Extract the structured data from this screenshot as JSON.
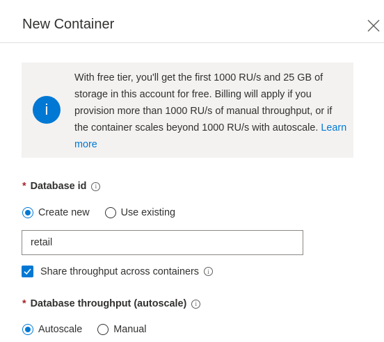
{
  "panel": {
    "title": "New Container",
    "close_icon": "close-icon"
  },
  "info_banner": {
    "icon": "info-icon",
    "icon_glyph": "i",
    "text": "With free tier, you'll get the first 1000 RU/s and 25 GB of storage in this account for free. Billing will apply if you provision more than 1000 RU/s of manual throughput, or if the container scales beyond 1000 RU/s with autoscale.",
    "link_text": "Learn more"
  },
  "database_id": {
    "required_mark": "*",
    "label": "Database id",
    "info_glyph": "i",
    "options": [
      "Create new",
      "Use existing"
    ],
    "selected": "Create new",
    "value": "retail",
    "share_label": "Share throughput across containers",
    "share_checked": true
  },
  "throughput": {
    "required_mark": "*",
    "label": "Database throughput (autoscale)",
    "info_glyph": "i",
    "options": [
      "Autoscale",
      "Manual"
    ],
    "selected": "Autoscale"
  },
  "colors": {
    "accent": "#0078d4",
    "required": "#a4262c",
    "banner_bg": "#f3f2f1"
  }
}
